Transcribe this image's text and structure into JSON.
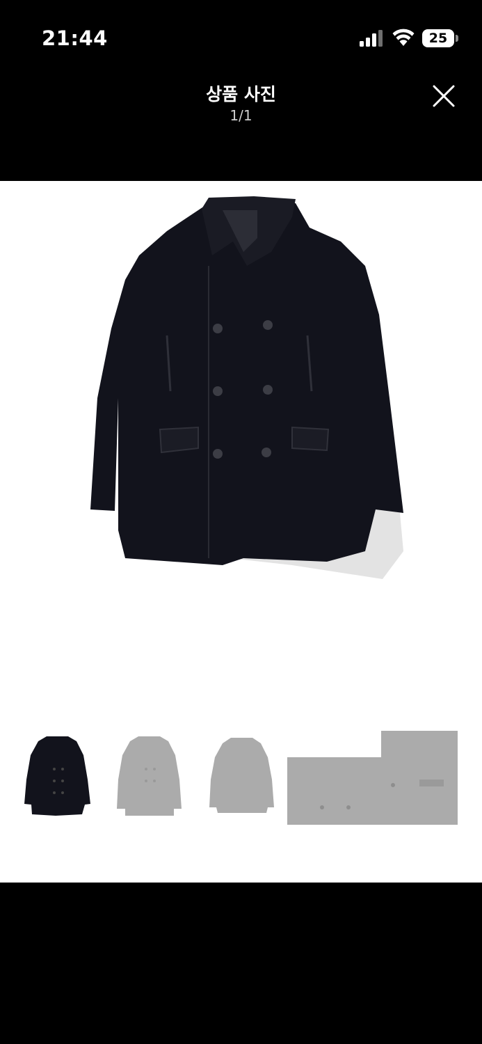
{
  "status_bar": {
    "time": "21:44",
    "battery_level": "25",
    "icons": [
      "signal-icon",
      "wifi-icon",
      "battery-icon"
    ]
  },
  "header": {
    "title": "상품 사진",
    "counter": "1/1",
    "close_icon": "close-icon"
  },
  "viewer": {
    "main_image": "navy double-breasted wool pea coat",
    "thumbnails": [
      {
        "name": "thumbnail-navy-coat",
        "selected": true
      },
      {
        "name": "thumbnail-coat-front",
        "selected": false
      },
      {
        "name": "thumbnail-coat-back",
        "selected": false
      },
      {
        "name": "thumbnail-coat-detail",
        "selected": false
      }
    ]
  },
  "colors": {
    "background": "#000000",
    "viewer_background": "#ffffff",
    "coat": "#12131c",
    "thumbnail_dimmed": "#ababab"
  }
}
